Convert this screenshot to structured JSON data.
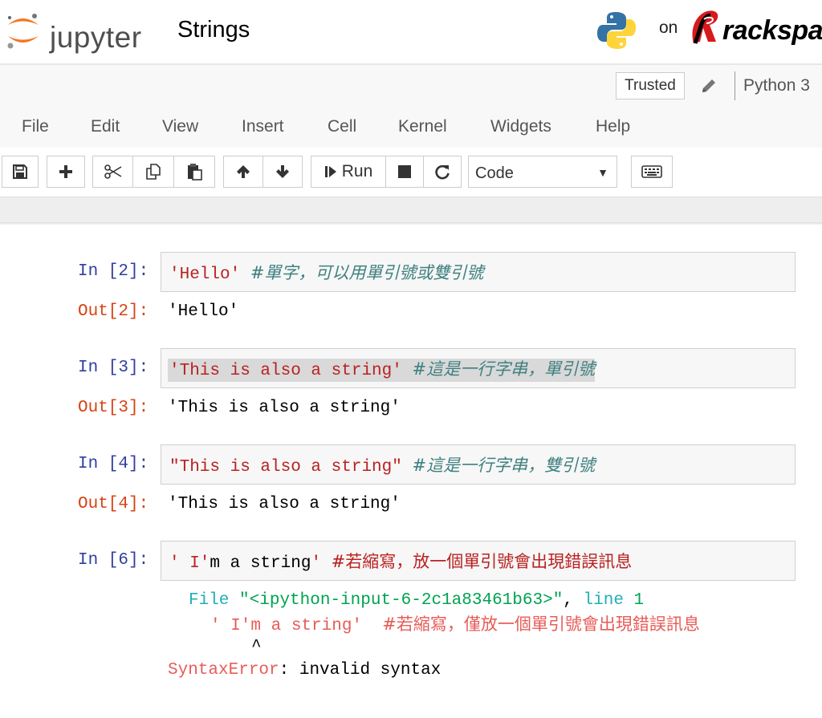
{
  "header": {
    "logo_text": "jupyter",
    "notebook_title": "Strings",
    "on_text": "on",
    "host_text": "rackspace"
  },
  "menubar": {
    "trusted_label": "Trusted",
    "kernel_name": "Python 3",
    "items": [
      "File",
      "Edit",
      "View",
      "Insert",
      "Cell",
      "Kernel",
      "Widgets",
      "Help"
    ]
  },
  "toolbar": {
    "run_label": "Run",
    "cell_type": "Code",
    "buttons": [
      "save-icon",
      "plus-icon",
      "scissors-icon",
      "copy-icon",
      "paste-icon",
      "arrow-up-icon",
      "arrow-down-icon",
      "step-forward-icon",
      "stop-icon",
      "restart-icon",
      "keyboard-icon"
    ]
  },
  "cells": [
    {
      "in_prompt": "In [2]:",
      "code_string": "'Hello'",
      "code_comment": "#單字，可以用單引號或雙引號",
      "out_prompt": "Out[2]:",
      "output": "'Hello'"
    },
    {
      "in_prompt": "In [3]:",
      "code_string": "'This is also a string'",
      "code_comment": "#這是一行字串，單引號",
      "out_prompt": "Out[3]:",
      "output": "'This is also a string'"
    },
    {
      "in_prompt": "In [4]:",
      "code_string": "\"This is also a string\"",
      "code_comment": "#這是一行字串，雙引號",
      "out_prompt": "Out[4]:",
      "output": "'This is also a string'"
    },
    {
      "in_prompt": "In [6]:",
      "code_string_a": "' I'",
      "code_plain": "m a string",
      "code_string_b": "'",
      "code_comment": "#若縮寫，放一個單引號會出現錯誤訊息",
      "traceback": {
        "file_label": "File",
        "file_name": "\"<ipython-input-6-2c1a83461b63>\"",
        "line_sep": ", ",
        "line_label": "line",
        "line_number": "1",
        "source_code": "' I'm a string'",
        "source_comment": "#若縮寫，僅放一個單引號會出現錯誤訊息",
        "caret": "^",
        "error_type": "SyntaxError",
        "error_sep": ":",
        "error_message": "invalid syntax"
      }
    }
  ],
  "colors": {
    "in_prompt": "#303f9f",
    "out_prompt": "#d84315",
    "string": "#ba2121",
    "comment": "#408080",
    "traceback_green": "#00a250",
    "traceback_red": "#e75c58"
  }
}
